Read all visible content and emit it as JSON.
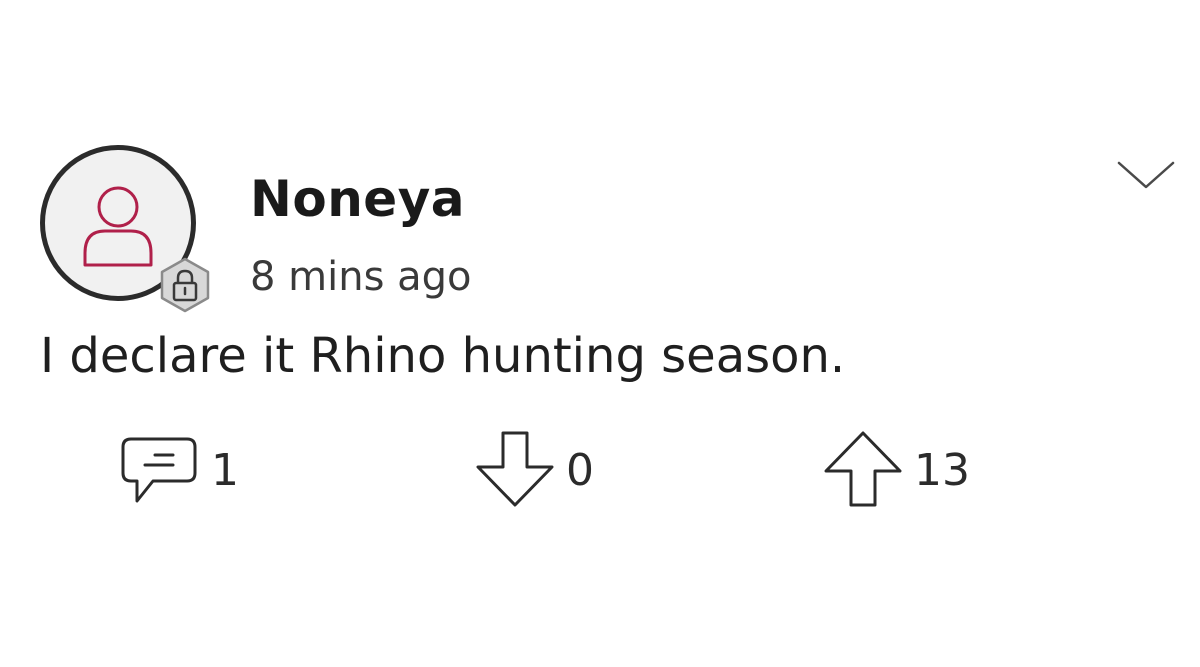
{
  "post": {
    "author": "Noneya",
    "timestamp": "8 mins ago",
    "text": "I declare it Rhino hunting season.",
    "avatar_icon": "person-outline-icon",
    "badge_icon": "lock-icon",
    "menu_icon": "chevron-down-icon"
  },
  "actions": {
    "comments": {
      "icon": "comment-icon",
      "count": "1"
    },
    "downvotes": {
      "icon": "arrow-down-icon",
      "count": "0"
    },
    "upvotes": {
      "icon": "arrow-up-icon",
      "count": "13"
    }
  },
  "colors": {
    "avatar_icon": "#b0204a",
    "text": "#1f1f1f",
    "badge_fill": "#d8d8d8"
  }
}
